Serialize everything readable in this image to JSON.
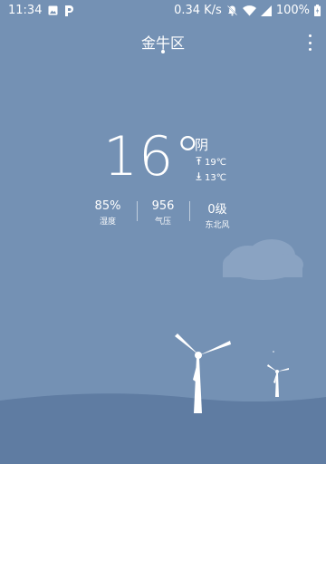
{
  "status_bar": {
    "time": "11:34",
    "network_speed": "0.34 K/s",
    "battery_percent": "100%",
    "left_icons": [
      "image-icon",
      "parking-app-icon"
    ],
    "right_icons": [
      "mute-bell-icon",
      "wifi-icon",
      "signal-icon",
      "battery-icon"
    ]
  },
  "header": {
    "location": "金牛区",
    "menu_icon": "more-vert-icon"
  },
  "current": {
    "temperature": "16°",
    "condition": "阴",
    "high": "19℃",
    "low": "13℃"
  },
  "stats": [
    {
      "value": "85%",
      "label": "湿度"
    },
    {
      "value": "956",
      "label": "气压"
    },
    {
      "value": "0级",
      "label": "东北风"
    }
  ],
  "colors": {
    "sky": "#7491b4",
    "hill": "#5e7ba1",
    "cloud": "#8ea6c4",
    "text": "#ffffff"
  }
}
